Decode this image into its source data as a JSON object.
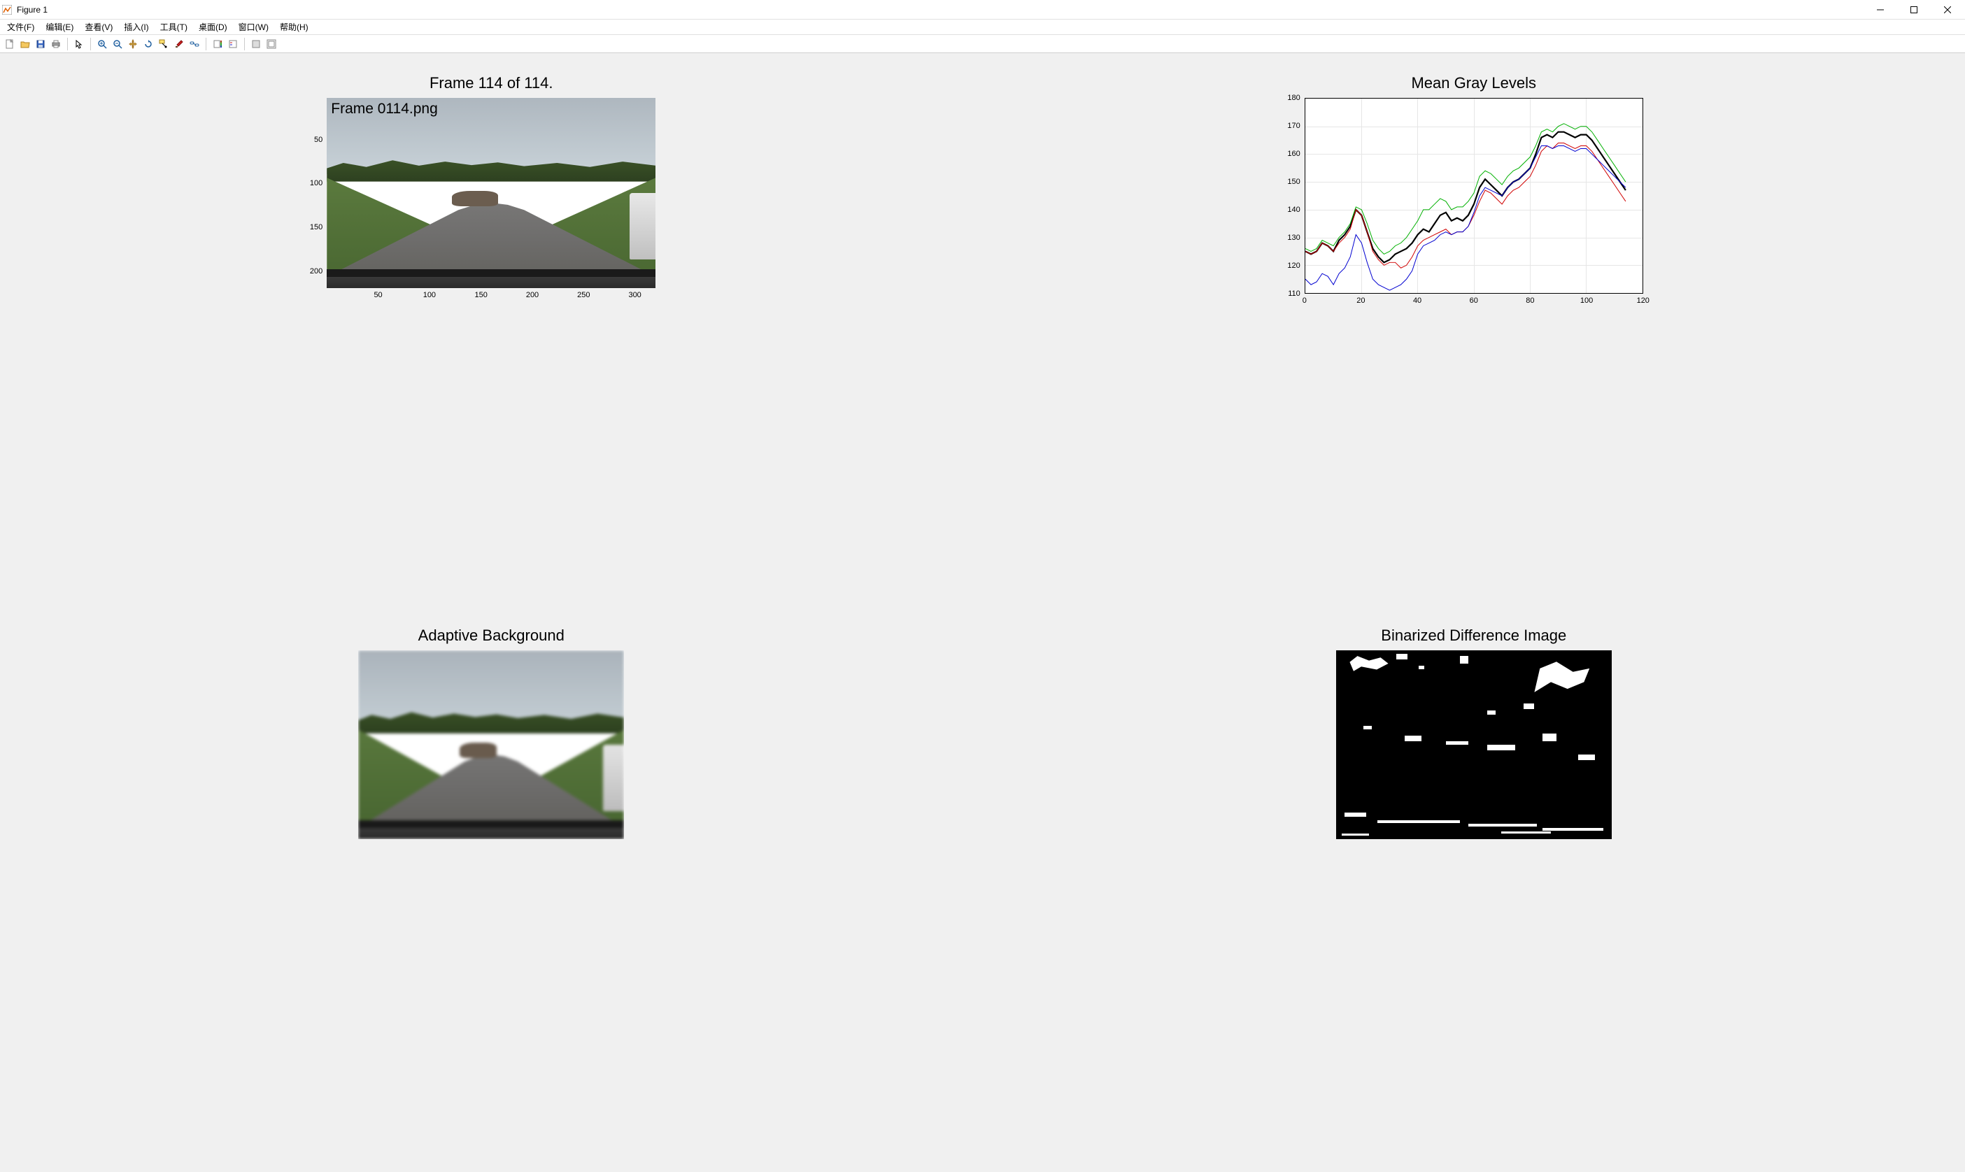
{
  "window": {
    "title": "Figure 1",
    "minimize": "–",
    "maximize": "□",
    "close": "✕"
  },
  "menu": {
    "file": "文件(F)",
    "edit": "编辑(E)",
    "view": "查看(V)",
    "insert": "插入(I)",
    "tools": "工具(T)",
    "desktop": "桌面(D)",
    "window": "窗口(W)",
    "help": "帮助(H)"
  },
  "subplot1": {
    "title": "Frame  114 of 114.",
    "overlay": "Frame 0114.png",
    "xticks": [
      "50",
      "100",
      "150",
      "200",
      "250",
      "300"
    ],
    "yticks": [
      "50",
      "100",
      "150",
      "200"
    ]
  },
  "subplot2": {
    "title": "Mean Gray Levels",
    "x_range": [
      0,
      120
    ],
    "y_range": [
      110,
      180
    ],
    "xticks": [
      "0",
      "20",
      "40",
      "60",
      "80",
      "100",
      "120"
    ],
    "yticks": [
      "110",
      "120",
      "130",
      "140",
      "150",
      "160",
      "170",
      "180"
    ]
  },
  "subplot3": {
    "title": "Adaptive Background"
  },
  "subplot4": {
    "title": "Binarized Difference Image"
  },
  "chart_data": {
    "type": "line",
    "title": "Mean Gray Levels",
    "xlabel": "",
    "ylabel": "",
    "xlim": [
      0,
      120
    ],
    "ylim": [
      110,
      180
    ],
    "x": [
      0,
      2,
      4,
      6,
      8,
      10,
      12,
      14,
      16,
      18,
      20,
      22,
      24,
      26,
      28,
      30,
      32,
      34,
      36,
      38,
      40,
      42,
      44,
      46,
      48,
      50,
      52,
      54,
      56,
      58,
      60,
      62,
      64,
      66,
      68,
      70,
      72,
      74,
      76,
      78,
      80,
      82,
      84,
      86,
      88,
      90,
      92,
      94,
      96,
      98,
      100,
      102,
      104,
      106,
      108,
      110,
      112,
      114
    ],
    "series": [
      {
        "name": "black",
        "color": "#000000",
        "width": 2.2,
        "values": [
          125,
          124,
          125,
          128,
          127,
          125,
          129,
          131,
          134,
          140,
          138,
          132,
          126,
          123,
          121,
          122,
          124,
          125,
          126,
          128,
          131,
          133,
          132,
          135,
          138,
          139,
          136,
          137,
          136,
          138,
          142,
          148,
          151,
          149,
          147,
          145,
          148,
          150,
          151,
          153,
          155,
          160,
          166,
          167,
          166,
          168,
          168,
          167,
          166,
          167,
          167,
          165,
          162,
          159,
          156,
          153,
          150,
          147
        ]
      },
      {
        "name": "green",
        "color": "#00b000",
        "width": 1.0,
        "values": [
          126,
          125,
          126,
          129,
          128,
          127,
          130,
          132,
          135,
          141,
          140,
          135,
          129,
          126,
          124,
          125,
          127,
          128,
          130,
          133,
          136,
          140,
          140,
          142,
          144,
          143,
          140,
          141,
          141,
          143,
          146,
          152,
          154,
          153,
          151,
          149,
          152,
          154,
          155,
          157,
          159,
          163,
          168,
          169,
          168,
          170,
          171,
          170,
          169,
          170,
          170,
          168,
          165,
          162,
          159,
          156,
          153,
          150
        ]
      },
      {
        "name": "red",
        "color": "#d00000",
        "width": 1.0,
        "values": [
          125,
          124,
          125,
          128,
          127,
          125,
          128,
          130,
          133,
          140,
          138,
          132,
          125,
          122,
          120,
          121,
          121,
          119,
          120,
          123,
          127,
          129,
          130,
          131,
          132,
          133,
          131,
          132,
          132,
          134,
          138,
          143,
          147,
          146,
          144,
          142,
          145,
          147,
          148,
          150,
          152,
          156,
          161,
          163,
          162,
          164,
          164,
          163,
          162,
          163,
          163,
          161,
          158,
          155,
          152,
          149,
          146,
          143
        ]
      },
      {
        "name": "blue",
        "color": "#0000d0",
        "width": 1.0,
        "values": [
          115,
          113,
          114,
          117,
          116,
          113,
          117,
          119,
          123,
          131,
          128,
          121,
          115,
          113,
          112,
          111,
          112,
          113,
          115,
          118,
          124,
          127,
          128,
          129,
          131,
          132,
          131,
          132,
          132,
          134,
          139,
          145,
          148,
          147,
          146,
          145,
          148,
          150,
          151,
          153,
          155,
          159,
          163,
          163,
          162,
          163,
          163,
          162,
          161,
          162,
          162,
          160,
          158,
          156,
          154,
          152,
          150,
          148
        ]
      }
    ]
  }
}
